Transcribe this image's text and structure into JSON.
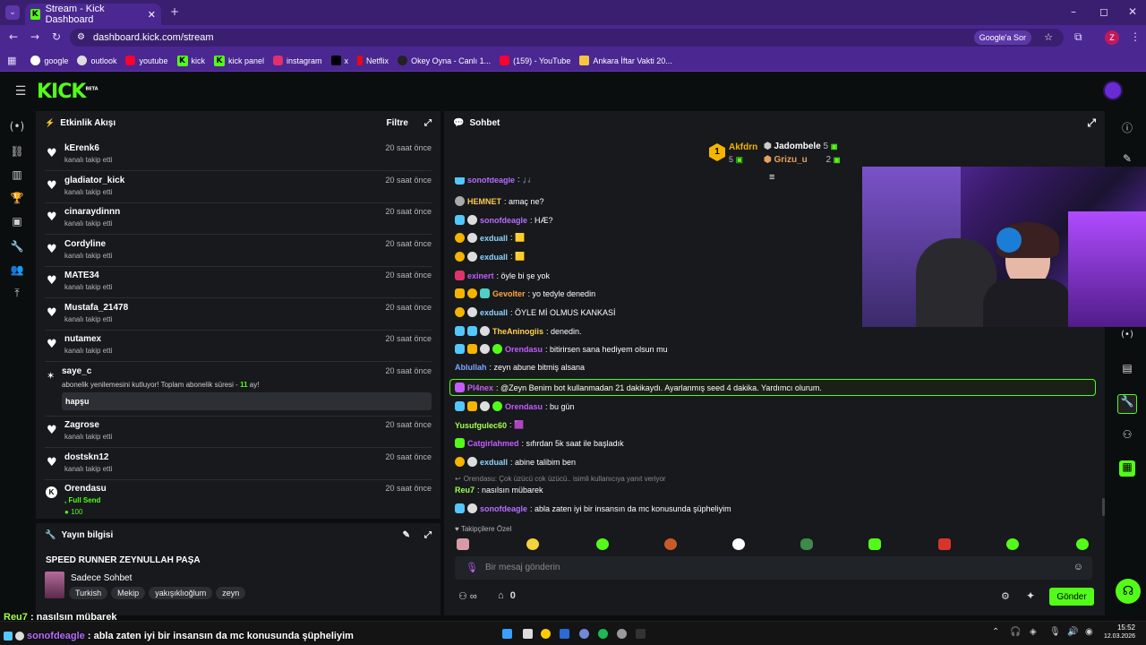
{
  "browser": {
    "tab_title": "Stream - Kick Dashboard",
    "url": "dashboard.kick.com/stream",
    "google_ask": "Google'a Sor",
    "profile_initial": "Z",
    "bookmarks": [
      "google",
      "outlook",
      "youtube",
      "kick",
      "kick panel",
      "instagram",
      "x",
      "Netflix",
      "Okey Oyna - Canlı 1...",
      "(159) - YouTube",
      "Ankara İftar Vakti 20..."
    ]
  },
  "app": {
    "logo": "KICK",
    "logo_badge": "BETA"
  },
  "activity": {
    "title": "Etkinlik Akışı",
    "filter": "Filtre",
    "items": [
      {
        "name": "kErenk6",
        "sub": "kanalı takip etti",
        "time": "20 saat önce"
      },
      {
        "name": "gladiator_kick",
        "sub": "kanalı takip etti",
        "time": "20 saat önce"
      },
      {
        "name": "cinaraydinnn",
        "sub": "kanalı takip etti",
        "time": "20 saat önce"
      },
      {
        "name": "Cordyline",
        "sub": "kanalı takip etti",
        "time": "20 saat önce"
      },
      {
        "name": "MATE34",
        "sub": "kanalı takip etti",
        "time": "20 saat önce"
      },
      {
        "name": "Mustafa_21478",
        "sub": "kanalı takip etti",
        "time": "20 saat önce"
      },
      {
        "name": "nutamex",
        "sub": "kanalı takip etti",
        "time": "20 saat önce"
      }
    ],
    "sub_item": {
      "name": "saye_c",
      "text": "abonelik yenilemesini kutluyor! Toplam abonelik süresi - ",
      "months": "11",
      "months_suffix": " ay!",
      "message": "hapşu",
      "time": "20 saat önce"
    },
    "items2": [
      {
        "name": "Zagrose",
        "sub": "kanalı takip etti",
        "time": "20 saat önce"
      },
      {
        "name": "dostskn12",
        "sub": "kanalı takip etti",
        "time": "20 saat önce"
      }
    ],
    "redeem": {
      "name": "Orendasu",
      "reward": ", Full Send",
      "points": "100",
      "time": "20 saat önce"
    }
  },
  "stream_info": {
    "title": "Yayın bilgisi",
    "stream_title": "SPEED RUNNER ZEYNULLAH PAŞA",
    "category": "Sadece Sohbet",
    "tags": [
      "Turkish",
      "Mekip",
      "yakışıklıoğlum",
      "zeyn"
    ]
  },
  "chat": {
    "title": "Sohbet",
    "leaderboard": {
      "first": {
        "name": "Akfdrn",
        "count": "5"
      },
      "second": {
        "name": "Jadombele",
        "count": "5"
      },
      "third": {
        "name": "Grizu_u",
        "count": "2"
      }
    },
    "messages": [
      {
        "user": "sonofdeagle",
        "color": "#b76cff",
        "text": ": 🎵"
      },
      {
        "user": "HEMNET",
        "color": "#ffc94d",
        "text": ": amaç ne?"
      },
      {
        "user": "sonofdeagle",
        "color": "#b76cff",
        "text": ": HÆ?"
      },
      {
        "user": "exduall",
        "color": "#8fd3ff",
        "text": ": 🟨"
      },
      {
        "user": "exduall",
        "color": "#8fd3ff",
        "text": ": 🟨"
      },
      {
        "user": "exinert",
        "color": "#c45cff",
        "text": ": öyle bi şe yok"
      },
      {
        "user": "Gevolter",
        "color": "#ffa53d",
        "text": ": yo tedyle denedin"
      },
      {
        "user": "exduall",
        "color": "#8fd3ff",
        "text": ": ÖYLE Mİ OLMUS KANKASİ"
      },
      {
        "user": "TheAninogiis",
        "color": "#ffd24d",
        "text": ": denedin."
      },
      {
        "user": "Orendasu",
        "color": "#c45cff",
        "text": ": bitirirsen sana hediyem olsun mu"
      },
      {
        "user": "Ablullah",
        "color": "#7aa7ff",
        "text": ": zeyn abune bitmiş alsana"
      },
      {
        "user": "Pl4nex",
        "color": "#c45cff",
        "text": ": @Zeyn Benim bot kullanmadan 21 dakikaydı. Ayarlanmış seed 4 dakika. Yardımcı olurum."
      },
      {
        "user": "Orendasu",
        "color": "#c45cff",
        "text": ": bu gün"
      },
      {
        "user": "Yusufgulec60",
        "color": "#a3ff4d",
        "text": ": 🟪"
      },
      {
        "user": "Catgirlahmed",
        "color": "#c45cff",
        "text": ": sıfırdan 5k saat ile başladık"
      },
      {
        "user": "exduall",
        "color": "#8fd3ff",
        "text": ": abine talibim ben"
      }
    ],
    "reply_hint": "Orendasu: Çok üzücü cok üzücü.. isimli kullanıcıya yanıt veriyor",
    "reply_msg": {
      "user": "Reu7",
      "color": "#a3ff4d",
      "text": ": nasılsın mübarek"
    },
    "last_msg": {
      "user": "sonofdeagle",
      "color": "#b76cff",
      "text": ": abla zaten iyi bir insansın da mc konusunda şüpheliyim"
    },
    "followers_only": "Takipçilere Özel",
    "input_placeholder": "Bir mesaj gönderin",
    "infinity": "∞",
    "gift_count": "0",
    "send": "Gönder"
  },
  "overlay": {
    "line1_user": "Reu7",
    "line1_text": " : nasılsın mübarek",
    "line2_user": "sonofdeagle",
    "line2_text": " : abla zaten iyi bir insansın da mc konusunda şüpheliyim"
  },
  "taskbar": {
    "time": "15:52",
    "date": "12.03.2026"
  },
  "colors": {
    "kick_green": "#53fc18",
    "browser_purple": "#4b2792"
  }
}
